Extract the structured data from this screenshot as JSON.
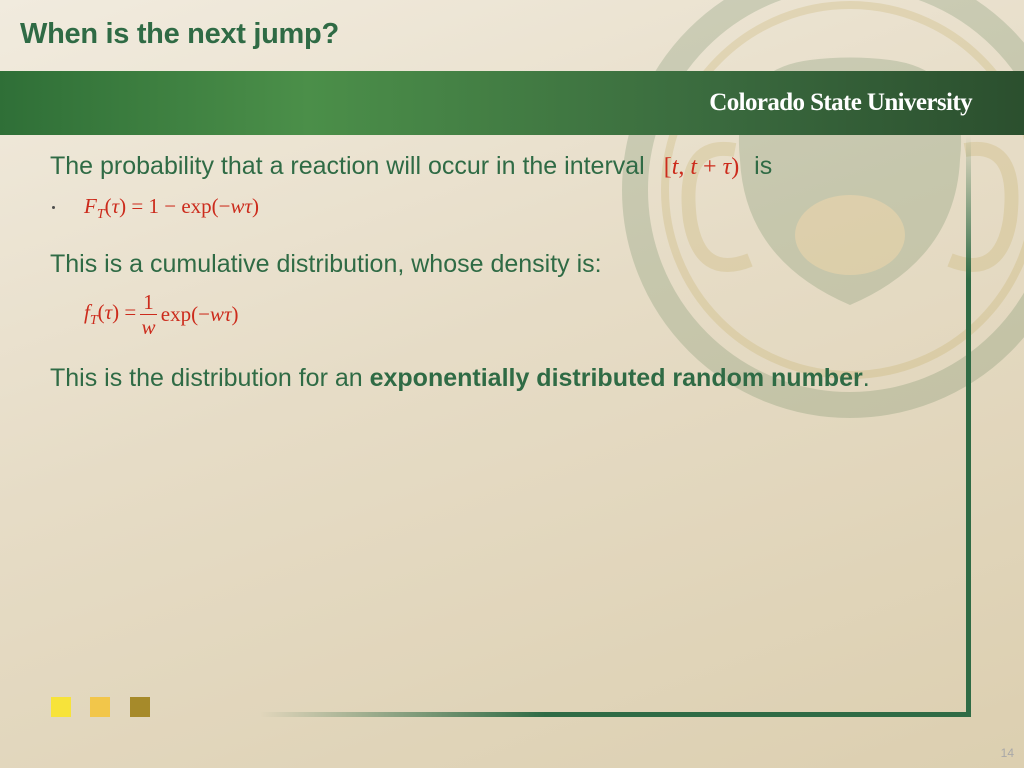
{
  "slide": {
    "title": "When is the next jump?",
    "logo": "Colorado State University",
    "page_number": "14"
  },
  "content": {
    "p1_text": "The probability that a reaction will occur in the interval",
    "p1_interval": "[t, t + τ)",
    "p1_suffix": "is",
    "eq1": "F_T(τ) = 1 − exp(−wτ)",
    "p2_text": "This is a cumulative distribution, whose density is:",
    "eq2": "f_T(τ) = (1/w) exp(−wτ)",
    "p3_prefix": "This is the distribution for an ",
    "p3_bold": "exponentially distributed random number",
    "p3_suffix": "."
  },
  "colors": {
    "title_green": "#2f6b45",
    "banner_green": "#3f7f42",
    "math_red": "#cc2b1c",
    "square_yellow": "#f7e33a",
    "square_amber": "#f2c64a",
    "square_olive": "#a68a2a"
  },
  "icons": {
    "watermark": "csu-ram-watermark-icon",
    "bullet": "bullet-dot-icon"
  }
}
